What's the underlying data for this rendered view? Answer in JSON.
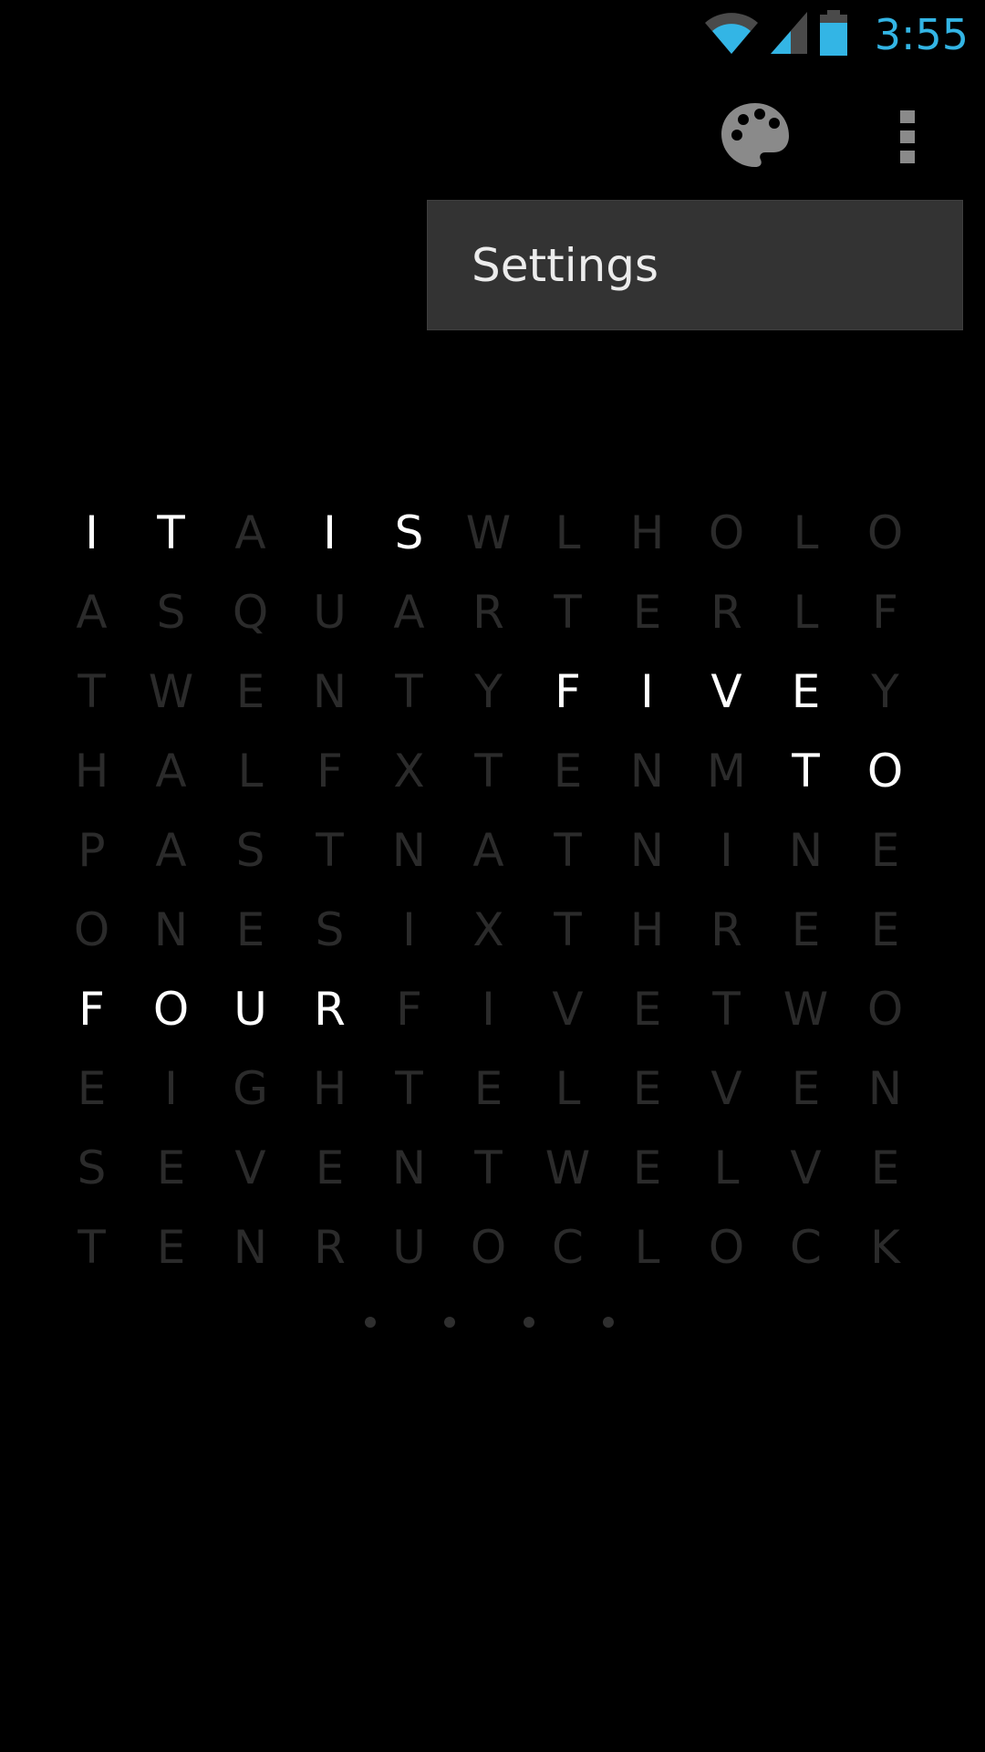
{
  "status_bar": {
    "time": "3:55",
    "icons": [
      "wifi-icon",
      "cell-signal-icon",
      "battery-icon"
    ],
    "accent_color": "#33b5e5"
  },
  "action_bar": {
    "icons": [
      "palette-icon",
      "overflow-menu-icon"
    ]
  },
  "menu": {
    "items": [
      {
        "label": "Settings"
      }
    ]
  },
  "clock": {
    "lit_color": "#ffffff",
    "dim_color": "#2b2b2b",
    "rows": [
      [
        "I",
        "T",
        "A",
        "I",
        "S",
        "W",
        "L",
        "H",
        "O",
        "L",
        "O"
      ],
      [
        "A",
        "S",
        "Q",
        "U",
        "A",
        "R",
        "T",
        "E",
        "R",
        "L",
        "F"
      ],
      [
        "T",
        "W",
        "E",
        "N",
        "T",
        "Y",
        "F",
        "I",
        "V",
        "E",
        "Y"
      ],
      [
        "H",
        "A",
        "L",
        "F",
        "X",
        "T",
        "E",
        "N",
        "M",
        "T",
        "O"
      ],
      [
        "P",
        "A",
        "S",
        "T",
        "N",
        "A",
        "T",
        "N",
        "I",
        "N",
        "E"
      ],
      [
        "O",
        "N",
        "E",
        "S",
        "I",
        "X",
        "T",
        "H",
        "R",
        "E",
        "E"
      ],
      [
        "F",
        "O",
        "U",
        "R",
        "F",
        "I",
        "V",
        "E",
        "T",
        "W",
        "O"
      ],
      [
        "E",
        "I",
        "G",
        "H",
        "T",
        "E",
        "L",
        "E",
        "V",
        "E",
        "N"
      ],
      [
        "S",
        "E",
        "V",
        "E",
        "N",
        "T",
        "W",
        "E",
        "L",
        "V",
        "E"
      ],
      [
        "T",
        "E",
        "N",
        "R",
        "U",
        "O",
        "C",
        "L",
        "O",
        "C",
        "K"
      ]
    ],
    "lit": [
      [
        0,
        0
      ],
      [
        0,
        1
      ],
      [
        0,
        3
      ],
      [
        0,
        4
      ],
      [
        2,
        6
      ],
      [
        2,
        7
      ],
      [
        2,
        8
      ],
      [
        2,
        9
      ],
      [
        3,
        9
      ],
      [
        3,
        10
      ],
      [
        6,
        0
      ],
      [
        6,
        1
      ],
      [
        6,
        2
      ],
      [
        6,
        3
      ]
    ],
    "minute_dots": 4
  }
}
